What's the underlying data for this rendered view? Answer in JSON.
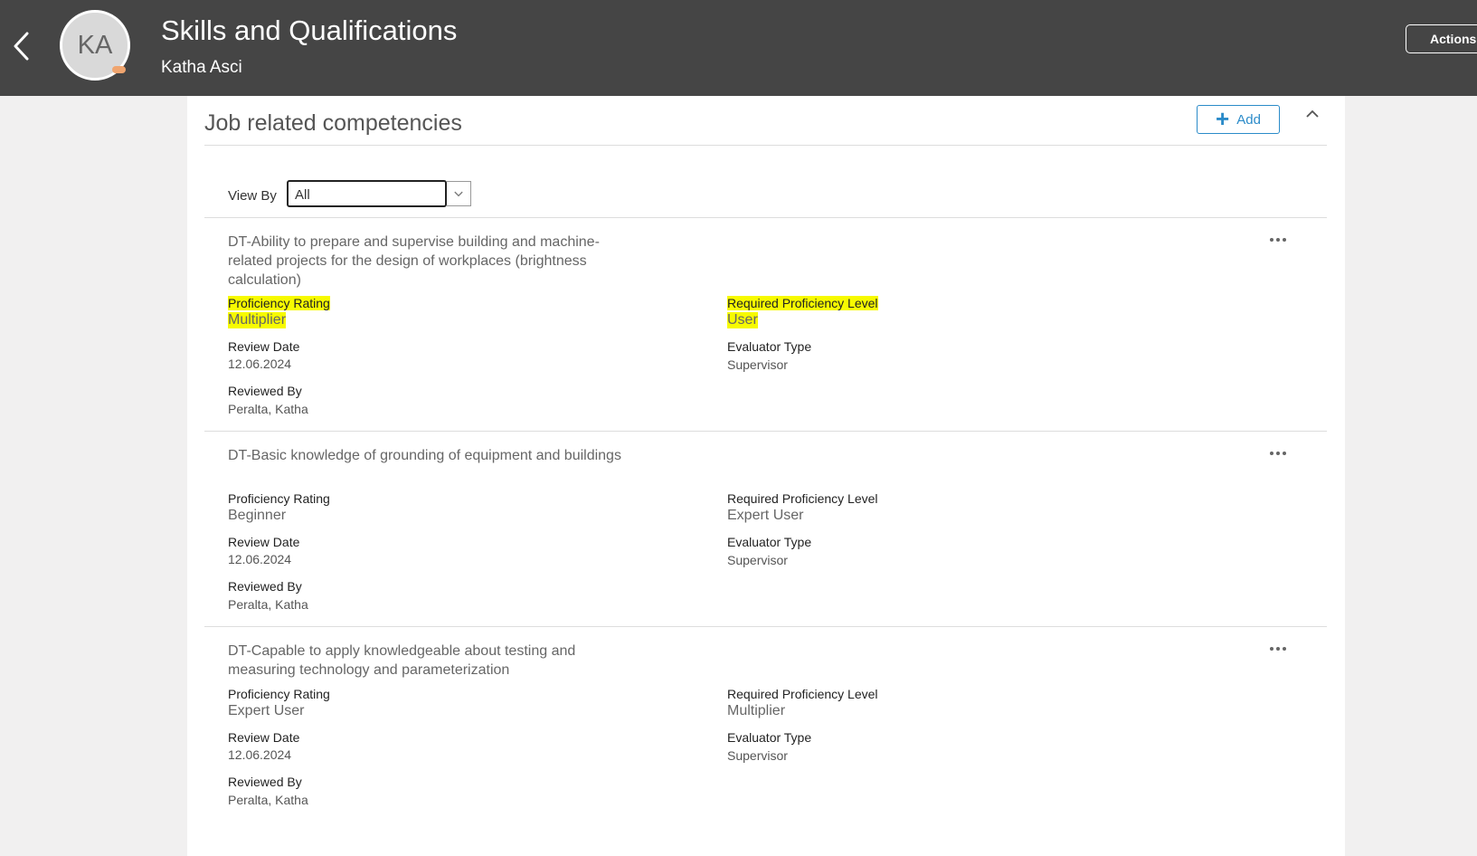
{
  "header": {
    "title": "Skills and Qualifications",
    "person_name": "Katha Asci",
    "avatar_initials": "KA",
    "actions_label": "Actions",
    "background": "#454545"
  },
  "section": {
    "title": "Job related competencies",
    "add_label": "Add",
    "view_by_label": "View By",
    "view_by_value": "All"
  },
  "items": [
    {
      "title": "DT-Ability to prepare and supervise building and machine-related projects for the design of workplaces (brightness calculation)",
      "proficiency_rating_label": "Proficiency Rating",
      "proficiency_rating": "Multiplier",
      "required_level_label": "Required Proficiency Level",
      "required_level": "User",
      "review_date_label": "Review Date",
      "review_date": "12.06.2024",
      "evaluator_type_label": "Evaluator Type",
      "evaluator_type": "Supervisor",
      "reviewed_by_label": "Reviewed By",
      "reviewed_by": "Peralta, Katha"
    },
    {
      "title": "DT-Basic knowledge of grounding of equipment and buildings",
      "proficiency_rating_label": "Proficiency Rating",
      "proficiency_rating": "Beginner",
      "required_level_label": "Required Proficiency Level",
      "required_level": "Expert User",
      "review_date_label": "Review Date",
      "review_date": "12.06.2024",
      "evaluator_type_label": "Evaluator Type",
      "evaluator_type": "Supervisor",
      "reviewed_by_label": "Reviewed By",
      "reviewed_by": "Peralta, Katha"
    },
    {
      "title": "DT-Capable to apply knowledgeable about testing and measuring technology and parameterization",
      "proficiency_rating_label": "Proficiency Rating",
      "proficiency_rating": "Expert User",
      "required_level_label": "Required Proficiency Level",
      "required_level": "Multiplier",
      "review_date_label": "Review Date",
      "review_date": "12.06.2024",
      "evaluator_type_label": "Evaluator Type",
      "evaluator_type": "Supervisor",
      "reviewed_by_label": "Reviewed By",
      "reviewed_by": "Peralta, Katha"
    }
  ],
  "icons": {
    "back": "back-chevron-icon",
    "add": "plus-icon",
    "collapse": "chevron-up-icon",
    "dropdown": "chevron-down-icon",
    "more": "more-actions-icon"
  },
  "accent_color": "#2b8bc9",
  "highlight_color": "#f7fa00"
}
